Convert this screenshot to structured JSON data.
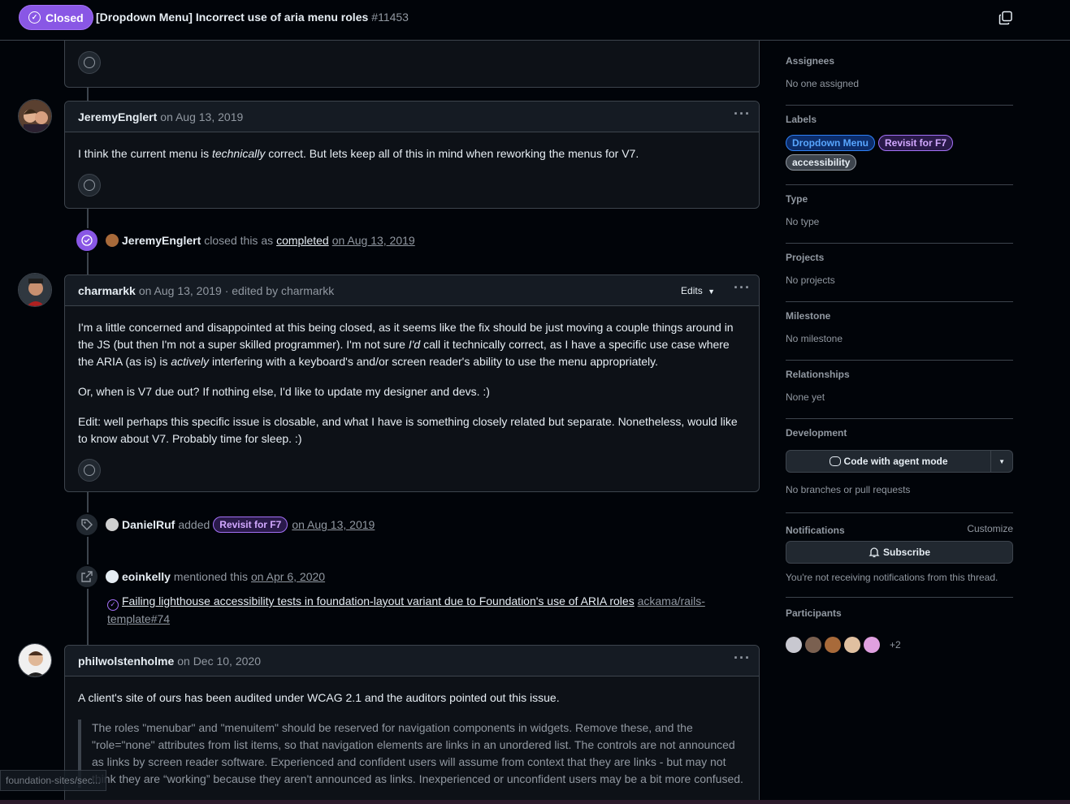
{
  "header": {
    "state": "Closed",
    "title": "[Dropdown Menu] Incorrect use of aria menu roles",
    "number": "#11453"
  },
  "comments": [
    {
      "author": "JeremyEnglert",
      "meta": "on Aug 13, 2019",
      "body_pre": "I think the current menu is ",
      "body_em": "technically",
      "body_post": " correct. But lets keep all of this in mind when reworking the menus for V7."
    },
    {
      "author": "charmarkk",
      "meta": "on Aug 13, 2019 · edited by charmarkk",
      "edits_label": "Edits",
      "p1_a": "I'm a little concerned and disappointed at this being closed, as it seems like the fix should be just moving a couple things around in the JS (but then I'm not a super skilled programmer). I'm not sure ",
      "p1_em1": "I'd",
      "p1_b": " call it technically correct, as I have a specific use case where the ARIA (as is) is ",
      "p1_em2": "actively",
      "p1_c": " interfering with a keyboard's and/or screen reader's ability to use the menu appropriately.",
      "p2": "Or, when is V7 due out? If nothing else, I'd like to update my designer and devs. :)",
      "p3": "Edit: well perhaps this specific issue is closable, and what I have is something closely related but separate. Nonetheless, would like to know about V7. Probably time for sleep. :)"
    },
    {
      "author": "philwolstenholme",
      "meta": "on Dec 10, 2020",
      "p1": "A client's site of ours has been audited under WCAG 2.1 and the auditors pointed out this issue.",
      "quote": "The roles \"menubar\" and \"menuitem\" should be reserved for navigation components in widgets. Remove these, and the \"role=\"none\" attributes from list items, so that navigation elements are links in an unordered list. The controls are not announced as links by screen reader software. Experienced and confident users will assume from context that they are links - but may not think they are “working” because they aren't announced as links. Inexperienced or unconfident users may be a bit more confused."
    }
  ],
  "events": {
    "closed": {
      "actor": "JeremyEnglert",
      "text": "closed this as",
      "state": "completed",
      "date": "on Aug 13, 2019"
    },
    "labeled": {
      "actor": "DanielRuf",
      "text": "added",
      "label": "Revisit for F7",
      "date": "on Aug 13, 2019"
    },
    "mentioned": {
      "actor": "eoinkelly",
      "text": "mentioned this",
      "date": "on Apr 6, 2020",
      "ref_title": "Failing lighthouse accessibility tests in foundation-layout variant due to Foundation's use of ARIA roles",
      "ref_repo": "ackama/rails-template#74"
    }
  },
  "sidebar": {
    "assignees": {
      "title": "Assignees",
      "value": "No one assigned"
    },
    "labels": {
      "title": "Labels",
      "items": [
        {
          "name": "Dropdown Menu",
          "color": "#2f81f7"
        },
        {
          "name": "Revisit for F7",
          "color": "#a371f7"
        },
        {
          "name": "accessibility",
          "color": "#9198a1"
        }
      ]
    },
    "type": {
      "title": "Type",
      "value": "No type"
    },
    "projects": {
      "title": "Projects",
      "value": "No projects"
    },
    "milestone": {
      "title": "Milestone",
      "value": "No milestone"
    },
    "relationships": {
      "title": "Relationships",
      "value": "None yet"
    },
    "development": {
      "title": "Development",
      "button": "Code with agent mode",
      "value": "No branches or pull requests"
    },
    "notifications": {
      "title": "Notifications",
      "customize": "Customize",
      "button": "Subscribe",
      "value": "You're not receiving notifications from this thread."
    },
    "participants": {
      "title": "Participants",
      "more": "+2"
    }
  },
  "status_url": "foundation-sites/sec...",
  "colors": {
    "accent_purple": "#8957e5",
    "bg": "#010409",
    "border": "#3d444d"
  }
}
